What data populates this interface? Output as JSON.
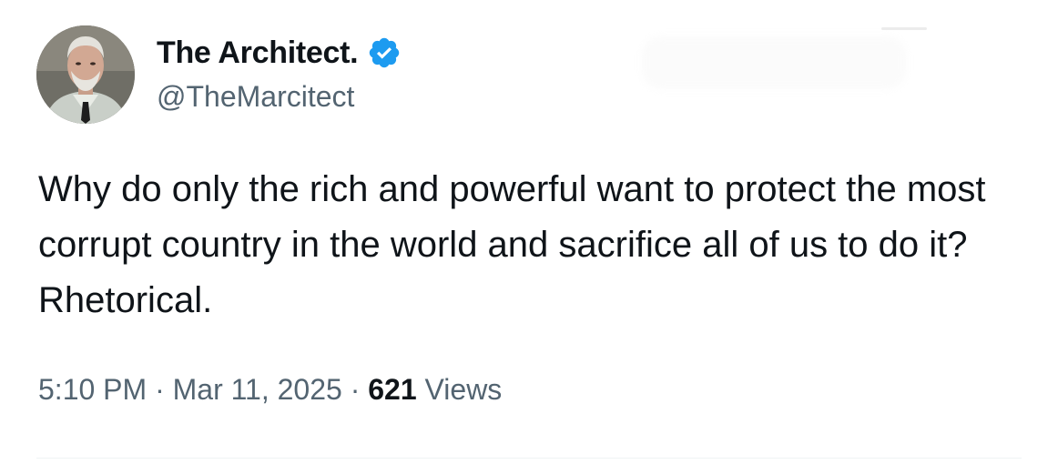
{
  "author": {
    "display_name": "The Architect.",
    "handle": "@TheMarcitect",
    "verified": true
  },
  "tweet": {
    "text": "Why do only the rich and powerful want to protect the most corrupt country in the world and sacrifice all of us to do it? Rhetorical.",
    "time": "5:10 PM",
    "date": "Mar 11, 2025",
    "separator": "·",
    "views_count": "621",
    "views_label": "Views"
  },
  "colors": {
    "text_primary": "#0f1419",
    "text_secondary": "#536471",
    "verified_badge": "#1d9bf0",
    "divider": "#eff3f4"
  },
  "icons": {
    "verified": "verified-badge-icon",
    "avatar": "profile-avatar"
  }
}
